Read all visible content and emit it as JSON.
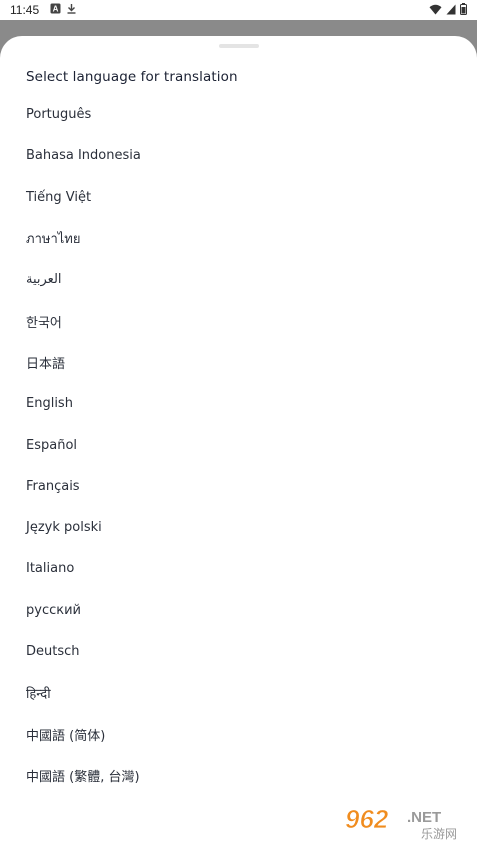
{
  "status_bar": {
    "time": "11:45",
    "icons": [
      "a-notification-icon",
      "download-icon",
      "wifi-icon",
      "signal-icon",
      "battery-icon"
    ]
  },
  "sheet": {
    "title": "Select language for translation",
    "languages": [
      "Português",
      "Bahasa Indonesia",
      "Tiếng Việt",
      "ภาษาไทย",
      "العربية",
      "한국어",
      "日本語",
      "English",
      "Español",
      "Français",
      "Język polski",
      "Italiano",
      "русский",
      "Deutsch",
      "हिन्दी",
      "中國語 (简体)",
      "中國語 (繁體, 台灣)"
    ]
  },
  "watermark": {
    "number": "962",
    "suffix": ".NET",
    "cn": "乐游网"
  },
  "colors": {
    "scrim": "#8a8a8a",
    "sheet_bg": "#ffffff",
    "title": "#1b2133",
    "text": "#2a2f3a",
    "watermark_orange": "#f08c1e"
  }
}
